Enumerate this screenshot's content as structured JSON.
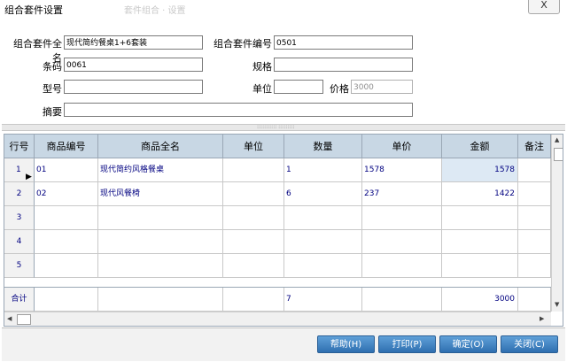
{
  "window": {
    "title": "组合套件设置",
    "blurred_title": "套件组合 · 设置",
    "close_label": "X"
  },
  "form": {
    "full_name_label": "组合套件全名",
    "full_name_value": "现代简约餐桌1+6套装",
    "code_label": "组合套件编号",
    "code_value": "0501",
    "barcode_label": "条码",
    "barcode_value": "0061",
    "spec_label": "规格",
    "spec_value": "",
    "model_label": "型号",
    "model_value": "",
    "unit_label": "单位",
    "unit_value": "",
    "price_label": "价格",
    "price_value": "3000",
    "summary_label": "摘要",
    "summary_value": ""
  },
  "splitter_grip": "::::::::::: :::::::::",
  "grid": {
    "columns": [
      "行号",
      "商品编号",
      "商品全名",
      "单位",
      "数量",
      "单价",
      "金额",
      "备注"
    ],
    "rows": [
      {
        "no": "1",
        "code": "01",
        "name": "现代简约风格餐桌",
        "unit": "",
        "qty": "1",
        "price": "1578",
        "amount": "1578",
        "note": ""
      },
      {
        "no": "2",
        "code": "02",
        "name": "现代风餐椅",
        "unit": "",
        "qty": "6",
        "price": "237",
        "amount": "1422",
        "note": ""
      },
      {
        "no": "3",
        "code": "",
        "name": "",
        "unit": "",
        "qty": "",
        "price": "",
        "amount": "",
        "note": ""
      },
      {
        "no": "4",
        "code": "",
        "name": "",
        "unit": "",
        "qty": "",
        "price": "",
        "amount": "",
        "note": ""
      },
      {
        "no": "5",
        "code": "",
        "name": "",
        "unit": "",
        "qty": "",
        "price": "",
        "amount": "",
        "note": ""
      }
    ],
    "total": {
      "label": "合计",
      "qty": "7",
      "amount": "3000"
    },
    "current_row_marker": "▶"
  },
  "buttons": {
    "help": "帮助(H)",
    "print": "打印(P)",
    "confirm": "确定(O)",
    "close": "关闭(C)"
  },
  "colors": {
    "header_bg": "#c8d7e4",
    "button_bg": "#3a7fc0",
    "grid_text": "#000080"
  }
}
